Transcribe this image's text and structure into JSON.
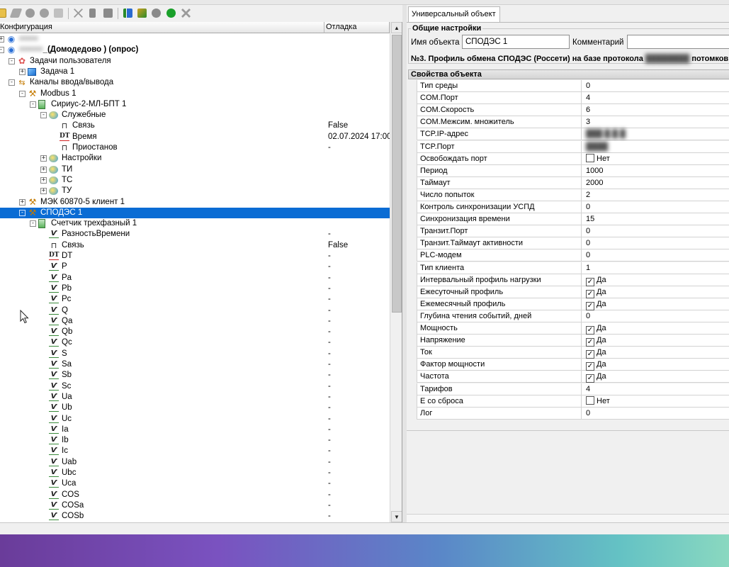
{
  "toolbar": {
    "buttons": [
      "open-icon",
      "edit-icon",
      "add-object-icon",
      "add-group-icon",
      "add-channel-icon",
      "delete-icon",
      "copy-icon",
      "paste-icon",
      "tree-icon",
      "sync-icon",
      "info-icon",
      "apply-icon",
      "cancel-icon"
    ]
  },
  "left": {
    "columns": [
      "Конфигурация",
      "Отладка"
    ],
    "tree": [
      {
        "label": "≡≡≡≡",
        "blurred": true,
        "icon": "globe",
        "level": 0,
        "expander": "+",
        "debug": ""
      },
      {
        "label": "_(Домодедово ) (опрос)",
        "prefix": "≡≡≡≡≡",
        "bold": true,
        "icon": "globe",
        "level": 0,
        "expander": "-",
        "debug": ""
      },
      {
        "label": "Задачи пользователя",
        "icon": "tasks",
        "level": 1,
        "expander": "-",
        "debug": ""
      },
      {
        "label": "Задача 1",
        "icon": "box",
        "level": 2,
        "expander": "+",
        "debug": ""
      },
      {
        "label": "Каналы ввода/вывода",
        "icon": "plug",
        "level": 1,
        "expander": "-",
        "debug": ""
      },
      {
        "label": "Modbus 1",
        "icon": "tool",
        "level": 2,
        "expander": "-",
        "debug": ""
      },
      {
        "label": "Сириус-2-МЛ-БПТ 1",
        "icon": "dev",
        "level": 3,
        "expander": "-",
        "debug": ""
      },
      {
        "label": "Служебные",
        "icon": "folder",
        "level": 4,
        "expander": "-",
        "debug": ""
      },
      {
        "label": "Связь",
        "icon": "pulse",
        "level": 5,
        "expander": "",
        "debug": "False"
      },
      {
        "label": "Время",
        "icon": "dt",
        "level": 5,
        "expander": "",
        "debug": "02.07.2024 17:00"
      },
      {
        "label": "Приостанов",
        "icon": "pulse",
        "level": 5,
        "expander": "",
        "debug": "-"
      },
      {
        "label": "Настройки",
        "icon": "folder",
        "level": 4,
        "expander": "+",
        "debug": ""
      },
      {
        "label": "ТИ",
        "icon": "folder",
        "level": 4,
        "expander": "+",
        "debug": ""
      },
      {
        "label": "ТС",
        "icon": "folder",
        "level": 4,
        "expander": "+",
        "debug": ""
      },
      {
        "label": "ТУ",
        "icon": "folder",
        "level": 4,
        "expander": "+",
        "debug": ""
      },
      {
        "label": "МЭК 60870-5 клиент 1",
        "icon": "tool",
        "level": 2,
        "expander": "+",
        "debug": ""
      },
      {
        "label": "СПОДЭС 1",
        "icon": "tool",
        "level": 2,
        "expander": "-",
        "debug": "",
        "selected": true
      },
      {
        "label": "Счетчик трехфазный 1",
        "icon": "dev",
        "level": 3,
        "expander": "-",
        "debug": ""
      },
      {
        "label": "РазностьВремени",
        "icon": "sig",
        "level": 4,
        "expander": "",
        "debug": "-"
      },
      {
        "label": "Связь",
        "icon": "pulse",
        "level": 4,
        "expander": "",
        "debug": "False"
      },
      {
        "label": "DT",
        "icon": "dt",
        "level": 4,
        "expander": "",
        "debug": "-"
      },
      {
        "label": "P",
        "icon": "sig",
        "level": 4,
        "expander": "",
        "debug": "-"
      },
      {
        "label": "Pa",
        "icon": "sig",
        "level": 4,
        "expander": "",
        "debug": "-"
      },
      {
        "label": "Pb",
        "icon": "sig",
        "level": 4,
        "expander": "",
        "debug": "-"
      },
      {
        "label": "Pc",
        "icon": "sig",
        "level": 4,
        "expander": "",
        "debug": "-"
      },
      {
        "label": "Q",
        "icon": "sig",
        "level": 4,
        "expander": "",
        "debug": "-"
      },
      {
        "label": "Qa",
        "icon": "sig",
        "level": 4,
        "expander": "",
        "debug": "-"
      },
      {
        "label": "Qb",
        "icon": "sig",
        "level": 4,
        "expander": "",
        "debug": "-"
      },
      {
        "label": "Qc",
        "icon": "sig",
        "level": 4,
        "expander": "",
        "debug": "-"
      },
      {
        "label": "S",
        "icon": "sig",
        "level": 4,
        "expander": "",
        "debug": "-"
      },
      {
        "label": "Sa",
        "icon": "sig",
        "level": 4,
        "expander": "",
        "debug": "-"
      },
      {
        "label": "Sb",
        "icon": "sig",
        "level": 4,
        "expander": "",
        "debug": "-"
      },
      {
        "label": "Sc",
        "icon": "sig",
        "level": 4,
        "expander": "",
        "debug": "-"
      },
      {
        "label": "Ua",
        "icon": "sig",
        "level": 4,
        "expander": "",
        "debug": "-"
      },
      {
        "label": "Ub",
        "icon": "sig",
        "level": 4,
        "expander": "",
        "debug": "-"
      },
      {
        "label": "Uc",
        "icon": "sig",
        "level": 4,
        "expander": "",
        "debug": "-"
      },
      {
        "label": "Ia",
        "icon": "sig",
        "level": 4,
        "expander": "",
        "debug": "-"
      },
      {
        "label": "Ib",
        "icon": "sig",
        "level": 4,
        "expander": "",
        "debug": "-"
      },
      {
        "label": "Ic",
        "icon": "sig",
        "level": 4,
        "expander": "",
        "debug": "-"
      },
      {
        "label": "Uab",
        "icon": "sig",
        "level": 4,
        "expander": "",
        "debug": "-"
      },
      {
        "label": "Ubc",
        "icon": "sig",
        "level": 4,
        "expander": "",
        "debug": "-"
      },
      {
        "label": "Uca",
        "icon": "sig",
        "level": 4,
        "expander": "",
        "debug": "-"
      },
      {
        "label": "COS",
        "icon": "sig",
        "level": 4,
        "expander": "",
        "debug": "-"
      },
      {
        "label": "COSa",
        "icon": "sig",
        "level": 4,
        "expander": "",
        "debug": "-"
      },
      {
        "label": "COSb",
        "icon": "sig",
        "level": 4,
        "expander": "",
        "debug": "-"
      }
    ]
  },
  "right": {
    "tab_label": "Универсальный объект",
    "general_title": "Общие настройки",
    "object_name_label": "Имя объекта",
    "object_name_value": "СПОДЭС 1",
    "comment_label": "Комментарий",
    "comment_value": "",
    "profile_prefix": "№3. Профиль обмена СПОДЭС (Россети) на базе протокола",
    "profile_hidden": "████████",
    "profile_suffix": "потомков с",
    "props_title": "Свойства объекта",
    "properties": [
      {
        "name": "Тип среды",
        "value": "0"
      },
      {
        "name": "COM.Порт",
        "value": "4"
      },
      {
        "name": "COM.Скорость",
        "value": "6"
      },
      {
        "name": "COM.Межсим. множитель",
        "value": "3"
      },
      {
        "name": "TCP.IP-адрес",
        "value": "███.█.█.█",
        "blurred": true
      },
      {
        "name": "TCP.Порт",
        "value": "████",
        "blurred": true
      },
      {
        "name": "Освобождать порт",
        "checkbox": true,
        "checked": false,
        "value": "Нет"
      },
      {
        "name": "Период",
        "value": "1000"
      },
      {
        "name": "Таймаут",
        "value": "2000"
      },
      {
        "name": "Число попыток",
        "value": "2"
      },
      {
        "name": "Контроль синхронизации УСПД",
        "value": "0"
      },
      {
        "name": "Синхронизация времени",
        "value": "15"
      },
      {
        "name": "Транзит.Порт",
        "value": "0"
      },
      {
        "name": "Транзит.Таймаут активности",
        "value": "0"
      },
      {
        "name": "PLC-модем",
        "value": "0"
      },
      {
        "name": "Тип клиента",
        "value": "1"
      },
      {
        "name": "Интервальный профиль нагрузки",
        "checkbox": true,
        "checked": true,
        "value": "Да"
      },
      {
        "name": "Ежесуточный профиль",
        "checkbox": true,
        "checked": true,
        "value": "Да"
      },
      {
        "name": "Ежемесячный профиль",
        "checkbox": true,
        "checked": true,
        "value": "Да"
      },
      {
        "name": "Глубина чтения событий, дней",
        "value": "0"
      },
      {
        "name": "Мощность",
        "checkbox": true,
        "checked": true,
        "value": "Да"
      },
      {
        "name": "Напряжение",
        "checkbox": true,
        "checked": true,
        "value": "Да"
      },
      {
        "name": "Ток",
        "checkbox": true,
        "checked": true,
        "value": "Да"
      },
      {
        "name": "Фактор мощности",
        "checkbox": true,
        "checked": true,
        "value": "Да"
      },
      {
        "name": "Частота",
        "checkbox": true,
        "checked": true,
        "value": "Да"
      },
      {
        "name": "Тарифов",
        "value": "4"
      },
      {
        "name": "E со сброса",
        "checkbox": true,
        "checked": false,
        "value": "Нет"
      },
      {
        "name": "Лог",
        "value": "0"
      }
    ]
  },
  "colors": {
    "selection": "#0a6cd4",
    "window_bg": "#f0f0f0"
  }
}
